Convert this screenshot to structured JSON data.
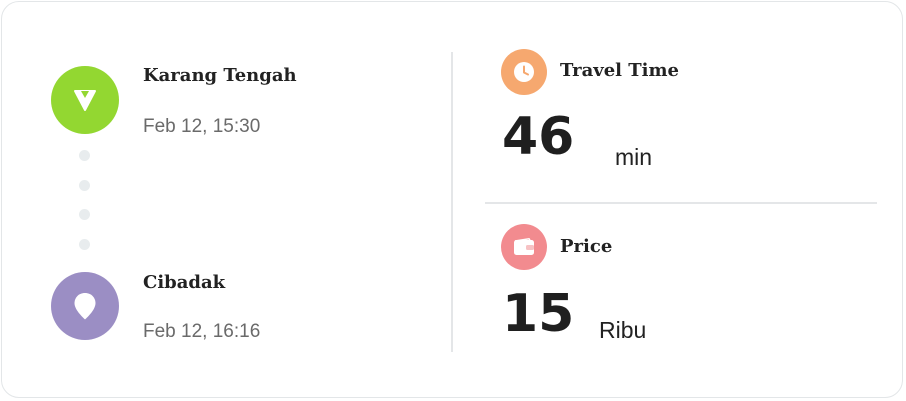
{
  "route": {
    "origin": {
      "name": "Karang Tengah",
      "time": "Feb 12, 15:30",
      "icon": "navigation-arrow-icon",
      "color": "#93d731"
    },
    "destination": {
      "name": "Cibadak",
      "time": "Feb 12, 16:16",
      "icon": "map-pin-icon",
      "color": "#9b8ec4"
    }
  },
  "stats": {
    "travel_time": {
      "label": "Travel Time",
      "value": "46",
      "unit": "min",
      "icon": "clock-icon",
      "color": "#f6a86f"
    },
    "price": {
      "label": "Price",
      "value": "15",
      "unit": "Ribu",
      "icon": "wallet-icon",
      "color": "#f28b8f"
    }
  }
}
